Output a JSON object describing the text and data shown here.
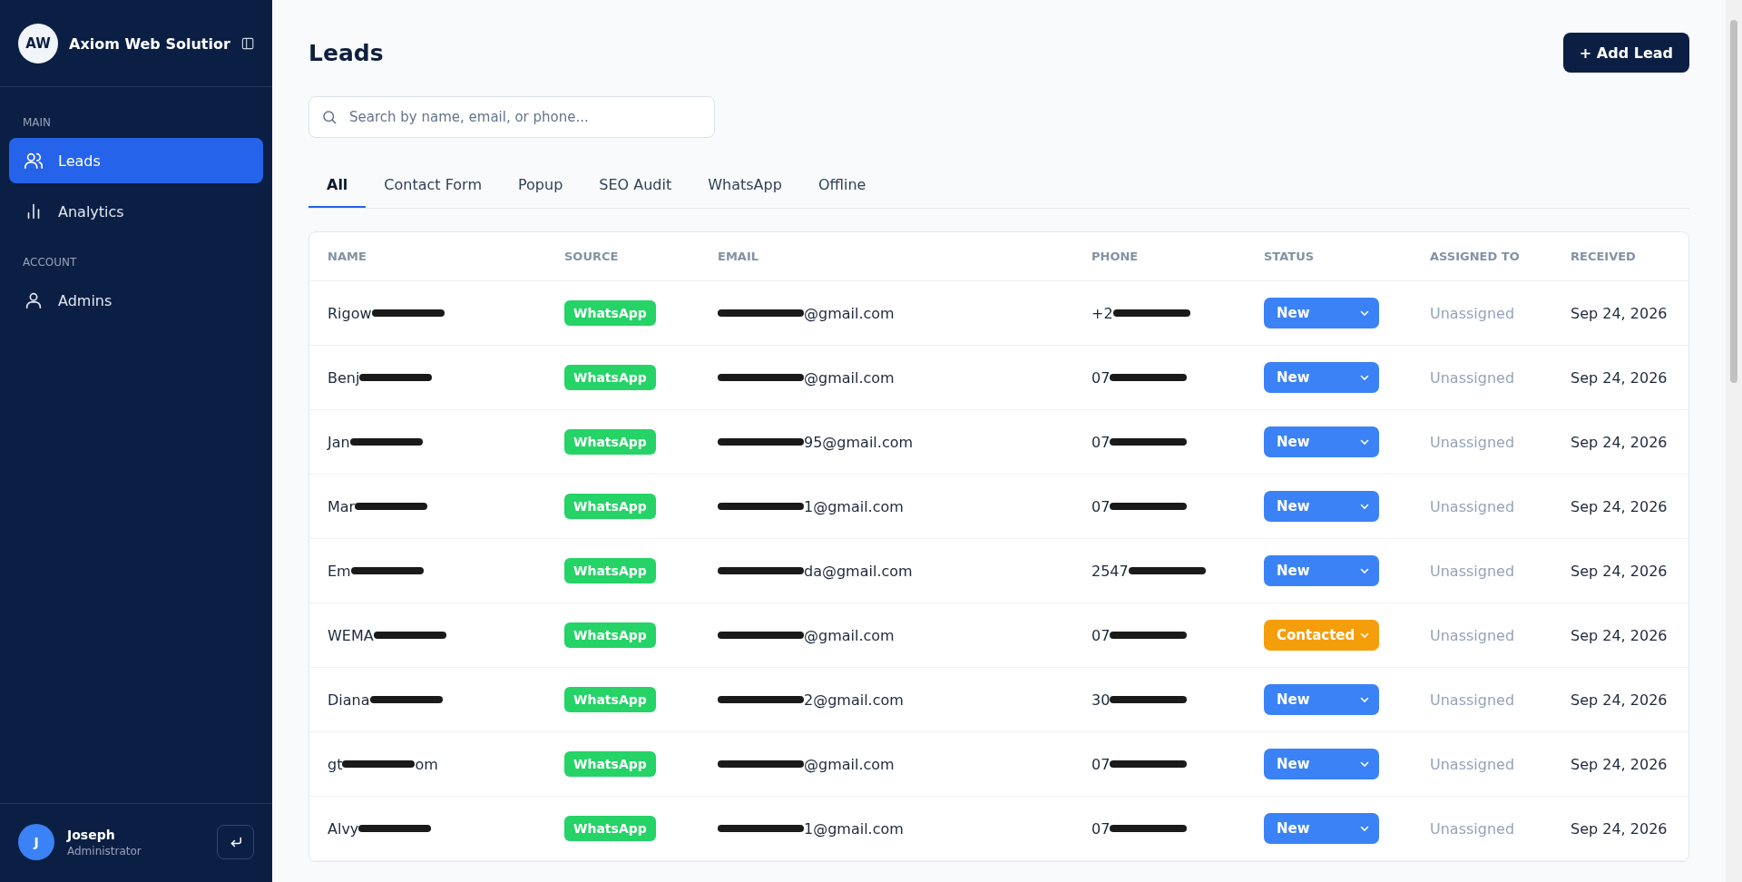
{
  "sidebar": {
    "brand": {
      "initials": "AW",
      "name": "Axiom Web Solutior"
    },
    "sections": [
      {
        "title": "MAIN",
        "items": [
          {
            "label": "Leads",
            "kind": "users",
            "selected": true
          },
          {
            "label": "Analytics",
            "kind": "chart",
            "selected": false
          }
        ]
      },
      {
        "title": "ACCOUNT",
        "items": [
          {
            "label": "Admins",
            "kind": "user",
            "selected": false
          }
        ]
      }
    ],
    "user": {
      "initial": "J",
      "name": "Joseph",
      "role": "Administrator"
    }
  },
  "page": {
    "title": "Leads",
    "add_button": "+ Add Lead",
    "search": {
      "placeholder": "Search by name, email, or phone..."
    },
    "tabs": [
      {
        "label": "All",
        "selected": true
      },
      {
        "label": "Contact Form",
        "selected": false
      },
      {
        "label": "Popup",
        "selected": false
      },
      {
        "label": "SEO Audit",
        "selected": false
      },
      {
        "label": "WhatsApp",
        "selected": false
      },
      {
        "label": "Offline",
        "selected": false
      }
    ]
  },
  "table": {
    "columns": [
      "NAME",
      "SOURCE",
      "EMAIL",
      "PHONE",
      "STATUS",
      "ASSIGNED TO",
      "RECEIVED"
    ],
    "rows": [
      {
        "name": {
          "prefix": "Rigow",
          "redacted": true
        },
        "source": "WhatsApp",
        "email": {
          "suffix": "@gmail.com",
          "redacted": true
        },
        "phone": {
          "prefix": "+2",
          "redacted": true
        },
        "status": "New",
        "color": "#3b82f6",
        "assigned": "Unassigned",
        "received": "Sep 24, 2026"
      },
      {
        "name": {
          "prefix": "Benj",
          "redacted": true
        },
        "source": "WhatsApp",
        "email": {
          "suffix": "@gmail.com",
          "redacted": true
        },
        "phone": {
          "prefix": "07",
          "redacted": true
        },
        "status": "New",
        "color": "#3b82f6",
        "assigned": "Unassigned",
        "received": "Sep 24, 2026"
      },
      {
        "name": {
          "prefix": "Jan",
          "redacted": true
        },
        "source": "WhatsApp",
        "email": {
          "suffix": "95@gmail.com",
          "redacted": true
        },
        "phone": {
          "prefix": "07",
          "redacted": true
        },
        "status": "New",
        "color": "#3b82f6",
        "assigned": "Unassigned",
        "received": "Sep 24, 2026"
      },
      {
        "name": {
          "prefix": "Mar",
          "redacted": true
        },
        "source": "WhatsApp",
        "email": {
          "suffix": "1@gmail.com",
          "redacted": true
        },
        "phone": {
          "prefix": "07",
          "redacted": true
        },
        "status": "New",
        "color": "#3b82f6",
        "assigned": "Unassigned",
        "received": "Sep 24, 2026"
      },
      {
        "name": {
          "prefix": "Em",
          "redacted": true
        },
        "source": "WhatsApp",
        "email": {
          "suffix": "da@gmail.com",
          "redacted": true
        },
        "phone": {
          "prefix": "2547",
          "redacted": true
        },
        "status": "New",
        "color": "#3b82f6",
        "assigned": "Unassigned",
        "received": "Sep 24, 2026"
      },
      {
        "name": {
          "prefix": "WEMA",
          "redacted": true
        },
        "source": "WhatsApp",
        "email": {
          "suffix": "@gmail.com",
          "redacted": true
        },
        "phone": {
          "prefix": "07",
          "redacted": true
        },
        "status": "Contacted",
        "color": "#f59e0b",
        "assigned": "Unassigned",
        "received": "Sep 24, 2026"
      },
      {
        "name": {
          "prefix": "Diana",
          "redacted": true
        },
        "source": "WhatsApp",
        "email": {
          "suffix": "2@gmail.com",
          "redacted": true
        },
        "phone": {
          "prefix": "30",
          "redacted": true
        },
        "status": "New",
        "color": "#3b82f6",
        "assigned": "Unassigned",
        "received": "Sep 24, 2026"
      },
      {
        "name": {
          "prefix": "gt",
          "redacted": true,
          "suffix": "om"
        },
        "source": "WhatsApp",
        "email": {
          "suffix": "@gmail.com",
          "redacted": true
        },
        "phone": {
          "prefix": "07",
          "redacted": true
        },
        "status": "New",
        "color": "#3b82f6",
        "assigned": "Unassigned",
        "received": "Sep 24, 2026"
      },
      {
        "name": {
          "prefix": "Alvy",
          "redacted": true
        },
        "source": "WhatsApp",
        "email": {
          "suffix": "1@gmail.com",
          "redacted": true
        },
        "phone": {
          "prefix": "07",
          "redacted": true
        },
        "status": "New",
        "color": "#3b82f6",
        "assigned": "Unassigned",
        "received": "Sep 24, 2026"
      }
    ]
  }
}
